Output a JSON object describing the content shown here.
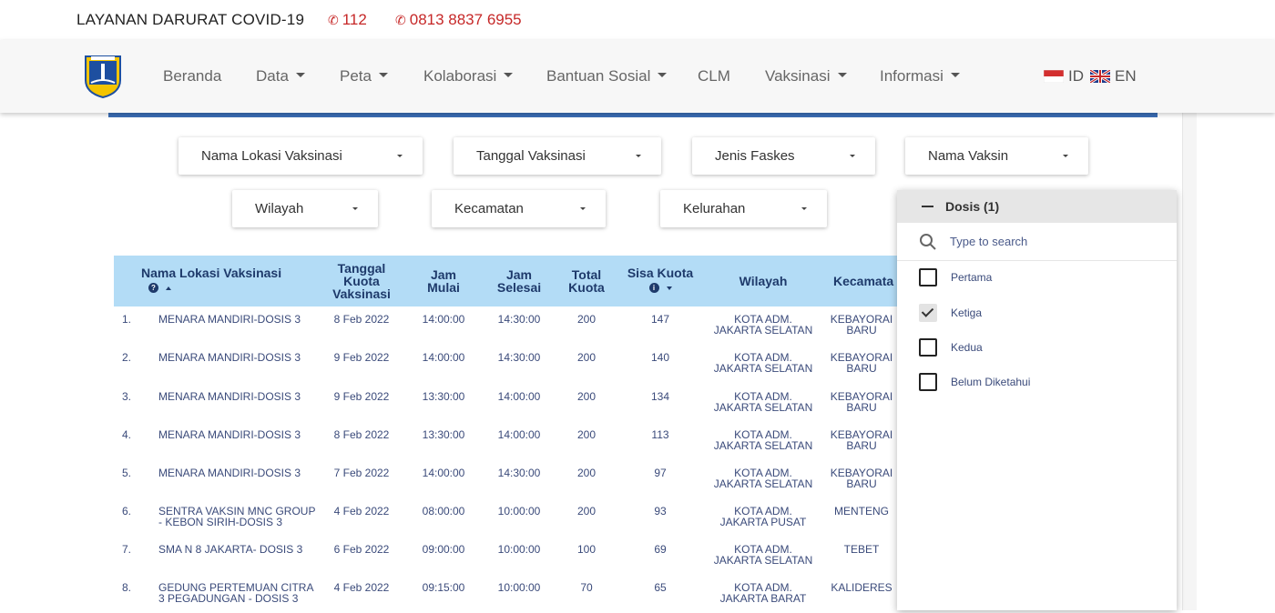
{
  "emergency": {
    "title": "LAYANAN DARURAT COVID-19",
    "phones": [
      "112",
      "0813 8837 6955"
    ]
  },
  "nav": {
    "items": [
      {
        "label": "Beranda",
        "dropdown": false
      },
      {
        "label": "Data",
        "dropdown": true
      },
      {
        "label": "Peta",
        "dropdown": true
      },
      {
        "label": "Kolaborasi",
        "dropdown": true
      },
      {
        "label": "Bantuan Sosial",
        "dropdown": true
      },
      {
        "label": "CLM",
        "dropdown": false
      },
      {
        "label": "Vaksinasi",
        "dropdown": true
      },
      {
        "label": "Informasi",
        "dropdown": true
      }
    ],
    "lang_id": "ID",
    "lang_en": "EN"
  },
  "filters": [
    "Nama Lokasi Vaksinasi",
    "Tanggal Vaksinasi",
    "Jenis Faskes",
    "Nama Vaksin",
    "Wilayah",
    "Kecamatan",
    "Kelurahan"
  ],
  "table": {
    "headers": {
      "lokasi": "Nama Lokasi Vaksinasi",
      "tanggal": [
        "Tanggal",
        "Kuota",
        "Vaksinasi"
      ],
      "mulai": [
        "Jam",
        "Mulai"
      ],
      "selesai": [
        "Jam",
        "Selesai"
      ],
      "total": [
        "Total",
        "Kuota"
      ],
      "sisa": "Sisa Kuota",
      "wilayah": "Wilayah",
      "kecamatan": "Kecamata"
    },
    "rows": [
      {
        "no": "1.",
        "lokasi": [
          "MENARA MANDIRI-DOSIS 3"
        ],
        "tanggal": "8 Feb 2022",
        "mulai": "14:00:00",
        "selesai": "14:30:00",
        "total": "200",
        "sisa": "147",
        "wilayah": [
          "KOTA ADM.",
          "JAKARTA SELATAN"
        ],
        "kecamatan": [
          "KEBAYORAI",
          "BARU"
        ]
      },
      {
        "no": "2.",
        "lokasi": [
          "MENARA MANDIRI-DOSIS 3"
        ],
        "tanggal": "9 Feb 2022",
        "mulai": "14:00:00",
        "selesai": "14:30:00",
        "total": "200",
        "sisa": "140",
        "wilayah": [
          "KOTA ADM.",
          "JAKARTA SELATAN"
        ],
        "kecamatan": [
          "KEBAYORAI",
          "BARU"
        ]
      },
      {
        "no": "3.",
        "lokasi": [
          "MENARA MANDIRI-DOSIS 3"
        ],
        "tanggal": "9 Feb 2022",
        "mulai": "13:30:00",
        "selesai": "14:00:00",
        "total": "200",
        "sisa": "134",
        "wilayah": [
          "KOTA ADM.",
          "JAKARTA SELATAN"
        ],
        "kecamatan": [
          "KEBAYORAI",
          "BARU"
        ]
      },
      {
        "no": "4.",
        "lokasi": [
          "MENARA MANDIRI-DOSIS 3"
        ],
        "tanggal": "8 Feb 2022",
        "mulai": "13:30:00",
        "selesai": "14:00:00",
        "total": "200",
        "sisa": "113",
        "wilayah": [
          "KOTA ADM.",
          "JAKARTA SELATAN"
        ],
        "kecamatan": [
          "KEBAYORAI",
          "BARU"
        ]
      },
      {
        "no": "5.",
        "lokasi": [
          "MENARA MANDIRI-DOSIS 3"
        ],
        "tanggal": "7 Feb 2022",
        "mulai": "14:00:00",
        "selesai": "14:30:00",
        "total": "200",
        "sisa": "97",
        "wilayah": [
          "KOTA ADM.",
          "JAKARTA SELATAN"
        ],
        "kecamatan": [
          "KEBAYORAI",
          "BARU"
        ]
      },
      {
        "no": "6.",
        "lokasi": [
          "SENTRA VAKSIN MNC GROUP",
          "- KEBON SIRIH-DOSIS 3"
        ],
        "tanggal": "4 Feb 2022",
        "mulai": "08:00:00",
        "selesai": "10:00:00",
        "total": "200",
        "sisa": "93",
        "wilayah": [
          "KOTA ADM.",
          "JAKARTA PUSAT"
        ],
        "kecamatan": [
          "MENTENG"
        ]
      },
      {
        "no": "7.",
        "lokasi": [
          "SMA N 8 JAKARTA- DOSIS 3"
        ],
        "tanggal": "6 Feb 2022",
        "mulai": "09:00:00",
        "selesai": "10:00:00",
        "total": "100",
        "sisa": "69",
        "wilayah": [
          "KOTA ADM.",
          "JAKARTA SELATAN"
        ],
        "kecamatan": [
          "TEBET"
        ]
      },
      {
        "no": "8.",
        "lokasi": [
          "GEDUNG PERTEMUAN CITRA",
          "3 PEGADUNGAN - DOSIS 3"
        ],
        "tanggal": "4 Feb 2022",
        "mulai": "09:15:00",
        "selesai": "10:00:00",
        "total": "70",
        "sisa": "65",
        "wilayah": [
          "KOTA ADM.",
          "JAKARTA BARAT"
        ],
        "kecamatan": [
          "KALIDERES"
        ]
      }
    ]
  },
  "dosis_panel": {
    "title": "Dosis (1)",
    "search_placeholder": "Type to search",
    "options": [
      {
        "label": "Pertama",
        "checked": false
      },
      {
        "label": "Ketiga",
        "checked": true
      },
      {
        "label": "Kedua",
        "checked": false
      },
      {
        "label": "Belum Diketahui",
        "checked": false
      }
    ]
  },
  "colors": {
    "accent": "#3a6db5",
    "header_bg": "#b3dcf6",
    "emergency": "#c62828",
    "text_blue": "#1e3a6b"
  }
}
